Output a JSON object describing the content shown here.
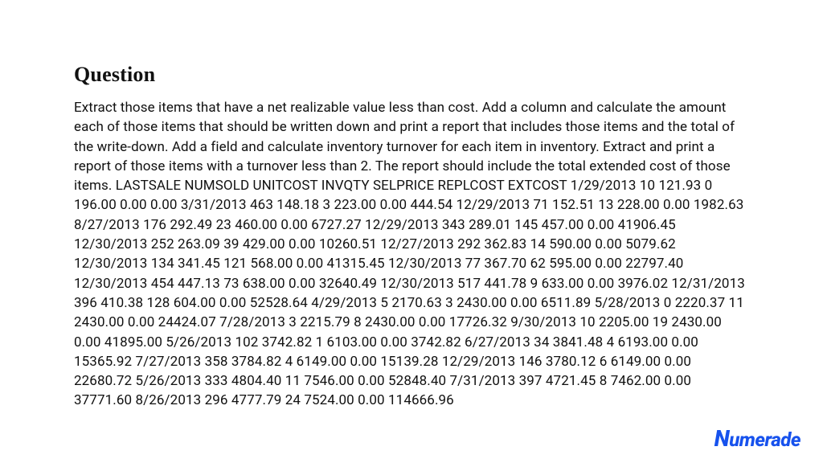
{
  "heading": "Question",
  "body": "Extract those items that have a net realizable value less than cost. Add a column and calculate the amount each of those items that should be written down and print a report that includes those items and the total of the write-down. Add a field and calculate inventory turnover for each item in inventory. Extract and print a report of those items with a turnover less than 2. The report should include the total extended cost of those items. LASTSALE NUMSOLD UNITCOST INVQTY SELPRICE REPLCOST EXTCOST 1/29/2013 10 121.93 0 196.00 0.00 0.00 3/31/2013 463 148.18 3 223.00 0.00 444.54 12/29/2013 71 152.51 13 228.00 0.00 1982.63 8/27/2013 176 292.49 23 460.00 0.00 6727.27 12/29/2013 343 289.01 145 457.00 0.00 41906.45 12/30/2013 252 263.09 39 429.00 0.00 10260.51 12/27/2013 292 362.83 14 590.00 0.00 5079.62 12/30/2013 134 341.45 121 568.00 0.00 41315.45 12/30/2013 77 367.70 62 595.00 0.00 22797.40 12/30/2013 454 447.13 73 638.00 0.00 32640.49 12/30/2013 517 441.78 9 633.00 0.00 3976.02 12/31/2013 396 410.38 128 604.00 0.00 52528.64 4/29/2013 5 2170.63 3 2430.00 0.00 6511.89 5/28/2013 0 2220.37 11 2430.00 0.00 24424.07 7/28/2013 3 2215.79 8 2430.00 0.00 17726.32 9/30/2013 10 2205.00 19 2430.00 0.00 41895.00 5/26/2013 102 3742.82 1 6103.00 0.00 3742.82 6/27/2013 34 3841.48 4 6193.00 0.00 15365.92 7/27/2013 358 3784.82 4 6149.00 0.00 15139.28 12/29/2013 146 3780.12 6 6149.00 0.00 22680.72 5/26/2013 333 4804.40 11 7546.00 0.00 52848.40 7/31/2013 397 4721.45 8 7462.00 0.00 37771.60 8/26/2013 296 4777.79 24 7524.00 0.00 114666.96",
  "brand": "Numerade"
}
